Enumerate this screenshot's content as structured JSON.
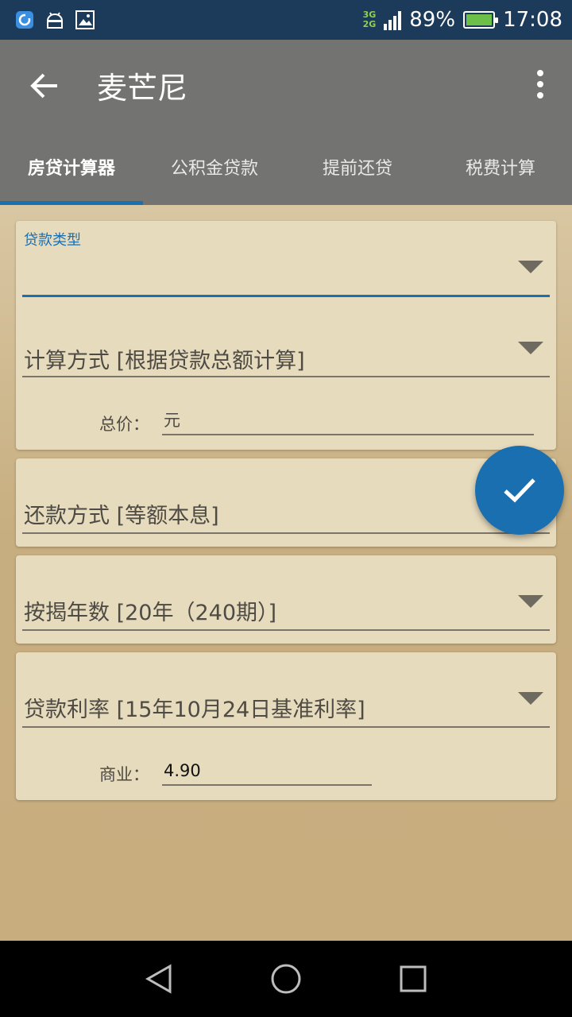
{
  "status_bar": {
    "icons": [
      "app-notification-icon",
      "android-debug-icon",
      "image-icon"
    ],
    "network_top": "3G",
    "network_bottom": "2G",
    "battery_percent": "89%",
    "battery_level": 0.89,
    "time": "17:08"
  },
  "app_bar": {
    "title": "麦芒尼",
    "back_icon": "arrow-left-icon",
    "menu_icon": "more-vert-icon",
    "tabs": [
      {
        "label": "房贷计算器",
        "active": true
      },
      {
        "label": "公积金贷款",
        "active": false
      },
      {
        "label": "提前还贷",
        "active": false
      },
      {
        "label": "税费计算",
        "active": false
      }
    ]
  },
  "form": {
    "loan_type": {
      "label": "贷款类型",
      "value": ""
    },
    "calc_method": {
      "text": "计算方式 [根据贷款总额计算]"
    },
    "total_price": {
      "label": "总价：",
      "placeholder": "元"
    },
    "repay_method": {
      "text": "还款方式 [等额本息]"
    },
    "mortgage_years": {
      "text": "按揭年数 [20年（240期）]"
    },
    "loan_rate": {
      "text": "贷款利率 [15年10月24日基准利率]"
    },
    "commercial_rate": {
      "label": "商业：",
      "value": "4.90"
    }
  },
  "fab": {
    "icon": "check-icon"
  },
  "nav_bar": {
    "icons": [
      "back-triangle-icon",
      "home-circle-icon",
      "recents-square-icon"
    ]
  },
  "colors": {
    "accent": "#1a6fb1",
    "card": "#e7dbbd",
    "appbar": "#737371"
  }
}
